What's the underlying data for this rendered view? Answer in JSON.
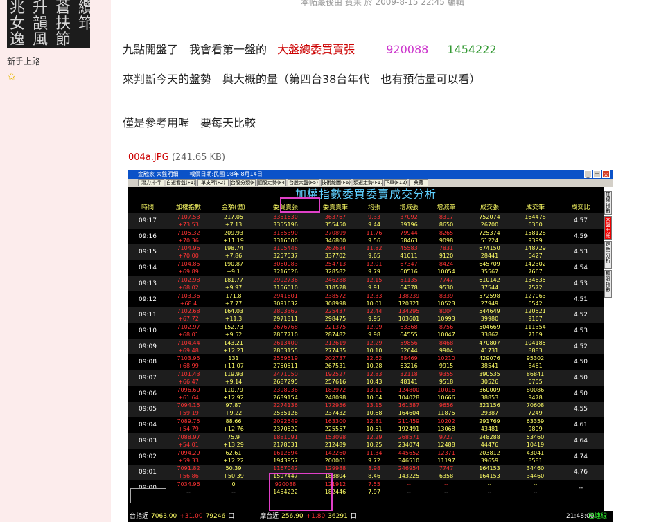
{
  "profile": {
    "avatar_rows": [
      "兆 升 蒼 纜",
      "女 韻 扶 筇 書",
      "逸 風 節"
    ],
    "rank": "新手上路",
    "star": "✩"
  },
  "post": {
    "edit_note": "本帖最後由 賓果 於 2009-8-15 22:45 編輯",
    "line1_a": "九點開盤了　我會看第一盤的",
    "line1_b": "大盤總委買賣張",
    "line1_c": "920088",
    "line1_d": "1454222",
    "line2": "來判斷今天的盤勢　與大概的量（第四台38台年代　也有預估量可以看）",
    "line3": "僅是參考用喔　要每天比較",
    "attachment_name": "004a.JPG",
    "attachment_size": "(241.65 KB)"
  },
  "app": {
    "window_title": "金融家 大盤明細　　報價日期:民國 98年 8月14日",
    "toolbar": [
      "潛力排行",
      "自選看盤(F1)",
      "單支所(F2)",
      "台股分類(F3)",
      "個股走勢(F4)",
      "台股大盤(F5)",
      "技術線圖(F6)",
      "類選走勢(F11)",
      "下單(F12)",
      "典藏"
    ],
    "title": "加權指數委買委賣成交分析",
    "headers": [
      "時間",
      "加權指數",
      "金額(億)",
      "委買賣張",
      "委賣賣筆",
      "均張",
      "增減張",
      "增減筆",
      "成交張",
      "成交筆",
      "成交比"
    ],
    "rows": [
      {
        "time": "09:17",
        "idx": "7107.53",
        "chg": "+73.53",
        "amt": "217.05",
        "amt2": "+7.13",
        "buy": "3351630",
        "buy2": "3355196",
        "sell": "363767",
        "sell2": "355450",
        "avg": "9.33",
        "avg2": "9.44",
        "dz": "37092",
        "dz2": "39196",
        "db": "8317",
        "db2": "8650",
        "vol": "752074",
        "vol2": "26700",
        "cnt": "164478",
        "cnt2": "6350",
        "ratio": "4.57"
      },
      {
        "time": "09:16",
        "idx": "7105.32",
        "chg": "+70.36",
        "amt": "209.93",
        "amt2": "+11.19",
        "buy": "3185390",
        "buy2": "3316000",
        "sell": "270899",
        "sell2": "346800",
        "avg": "11.76",
        "avg2": "9.56",
        "dz": "79944",
        "dz2": "58463",
        "db": "8265",
        "db2": "9098",
        "vol": "725374",
        "vol2": "51224",
        "cnt": "158128",
        "cnt2": "9399",
        "ratio": "4.59"
      },
      {
        "time": "09:15",
        "idx": "7104.96",
        "chg": "+70.00",
        "amt": "198.74",
        "amt2": "+7.86",
        "buy": "3105446",
        "buy2": "3257537",
        "sell": "262634",
        "sell2": "337702",
        "avg": "11.82",
        "avg2": "9.65",
        "dz": "45583",
        "dz2": "41011",
        "db": "7831",
        "db2": "9120",
        "vol": "674150",
        "vol2": "28441",
        "cnt": "148729",
        "cnt2": "6427",
        "ratio": "4.53"
      },
      {
        "time": "09:14",
        "idx": "7104.85",
        "chg": "+69.89",
        "amt": "190.87",
        "amt2": "+9.1",
        "buy": "3060083",
        "buy2": "3216526",
        "sell": "254713",
        "sell2": "328582",
        "avg": "12.01",
        "avg2": "9.79",
        "dz": "67347",
        "dz2": "60516",
        "db": "8424",
        "db2": "10054",
        "vol": "645709",
        "vol2": "35567",
        "cnt": "142302",
        "cnt2": "7667",
        "ratio": "4.54"
      },
      {
        "time": "09:13",
        "idx": "7102.98",
        "chg": "+68.02",
        "amt": "181.77",
        "amt2": "+9.97",
        "buy": "2992736",
        "buy2": "3156010",
        "sell": "246288",
        "sell2": "318528",
        "avg": "12.15",
        "avg2": "9.91",
        "dz": "51135",
        "dz2": "64378",
        "db": "7747",
        "db2": "9530",
        "vol": "610142",
        "vol2": "37544",
        "cnt": "134635",
        "cnt2": "7572",
        "ratio": "4.53"
      },
      {
        "time": "09:12",
        "idx": "7103.36",
        "chg": "+68.4",
        "amt": "171.8",
        "amt2": "+7.77",
        "buy": "2941601",
        "buy2": "3091632",
        "sell": "238572",
        "sell2": "308998",
        "avg": "12.33",
        "avg2": "10.01",
        "dz": "138239",
        "dz2": "120321",
        "db": "8339",
        "db2": "10523",
        "vol": "572598",
        "vol2": "27949",
        "cnt": "127063",
        "cnt2": "6542",
        "ratio": "4.51"
      },
      {
        "time": "09:11",
        "idx": "7102.68",
        "chg": "+67.72",
        "amt": "164.03",
        "amt2": "+11.3",
        "buy": "2803362",
        "buy2": "2971311",
        "sell": "225437",
        "sell2": "298475",
        "avg": "12.44",
        "avg2": "9.95",
        "dz": "134295",
        "dz2": "103601",
        "db": "8004",
        "db2": "10993",
        "vol": "544649",
        "vol2": "39980",
        "cnt": "120521",
        "cnt2": "9167",
        "ratio": "4.52"
      },
      {
        "time": "09:10",
        "idx": "7102.97",
        "chg": "+68.01",
        "amt": "152.73",
        "amt2": "+9.52",
        "buy": "2676768",
        "buy2": "2867710",
        "sell": "221375",
        "sell2": "287482",
        "avg": "12.09",
        "avg2": "9.98",
        "dz": "63368",
        "dz2": "64555",
        "db": "8756",
        "db2": "10047",
        "vol": "504669",
        "vol2": "33862",
        "cnt": "111354",
        "cnt2": "7169",
        "ratio": "4.53"
      },
      {
        "time": "09:09",
        "idx": "7104.44",
        "chg": "+69.48",
        "amt": "143.21",
        "amt2": "+12.21",
        "buy": "2613400",
        "buy2": "2803155",
        "sell": "212619",
        "sell2": "277435",
        "avg": "12.29",
        "avg2": "10.10",
        "dz": "59856",
        "dz2": "52644",
        "db": "8468",
        "db2": "9904",
        "vol": "470807",
        "vol2": "41731",
        "cnt": "104185",
        "cnt2": "8883",
        "ratio": "4.52"
      },
      {
        "time": "09:08",
        "idx": "7103.95",
        "chg": "+68.99",
        "amt": "131",
        "amt2": "+11.07",
        "buy": "2559519",
        "buy2": "2750511",
        "sell": "202737",
        "sell2": "267531",
        "avg": "12.62",
        "avg2": "10.28",
        "dz": "88469",
        "dz2": "63216",
        "db": "10210",
        "db2": "9915",
        "vol": "429076",
        "vol2": "38541",
        "cnt": "95302",
        "cnt2": "8461",
        "ratio": "4.50"
      },
      {
        "time": "09:07",
        "idx": "7101.43",
        "chg": "+66.47",
        "amt": "119.93",
        "amt2": "+9.14",
        "buy": "2471050",
        "buy2": "2687295",
        "sell": "192527",
        "sell2": "257616",
        "avg": "12.83",
        "avg2": "10.43",
        "dz": "32118",
        "dz2": "48141",
        "db": "9355",
        "db2": "9518",
        "vol": "390535",
        "vol2": "30526",
        "cnt": "86841",
        "cnt2": "6755",
        "ratio": "4.50"
      },
      {
        "time": "09:06",
        "idx": "7096.60",
        "chg": "+61.64",
        "amt": "110.79",
        "amt2": "+12.92",
        "buy": "2398936",
        "buy2": "2639154",
        "sell": "182972",
        "sell2": "248098",
        "avg": "13.11",
        "avg2": "10.64",
        "dz": "124800",
        "dz2": "104028",
        "db": "10016",
        "db2": "10666",
        "vol": "360009",
        "vol2": "38853",
        "cnt": "80086",
        "cnt2": "9478",
        "ratio": "4.50"
      },
      {
        "time": "09:05",
        "idx": "7094.15",
        "chg": "+59.19",
        "amt": "97.87",
        "amt2": "+9.22",
        "buy": "2274136",
        "buy2": "2535126",
        "sell": "172956",
        "sell2": "237432",
        "avg": "13.15",
        "avg2": "10.68",
        "dz": "161587",
        "dz2": "164604",
        "db": "9656",
        "db2": "11875",
        "vol": "321156",
        "vol2": "29387",
        "cnt": "70608",
        "cnt2": "7249",
        "ratio": "4.55"
      },
      {
        "time": "09:04",
        "idx": "7089.75",
        "chg": "+54.79",
        "amt": "88.66",
        "amt2": "+12.76",
        "buy": "2092549",
        "buy2": "2370522",
        "sell": "163300",
        "sell2": "225557",
        "avg": "12.81",
        "avg2": "10.51",
        "dz": "211459",
        "dz2": "192491",
        "db": "10202",
        "db2": "13068",
        "vol": "291769",
        "vol2": "43481",
        "cnt": "63359",
        "cnt2": "9899",
        "ratio": "4.61"
      },
      {
        "time": "09:03",
        "idx": "7088.97",
        "chg": "+54.01",
        "amt": "75.9",
        "amt2": "+13.29",
        "buy": "1881091",
        "buy2": "2178031",
        "sell": "153098",
        "sell2": "212489",
        "avg": "12.29",
        "avg2": "10.25",
        "dz": "268571",
        "dz2": "234074",
        "db": "9727",
        "db2": "12488",
        "vol": "248288",
        "vol2": "44476",
        "cnt": "53460",
        "cnt2": "10419",
        "ratio": "4.64"
      },
      {
        "time": "09:02",
        "idx": "7094.29",
        "chg": "+59.33",
        "amt": "62.61",
        "amt2": "+12.22",
        "buy": "1612694",
        "buy2": "1943957",
        "sell": "142260",
        "sell2": "200001",
        "avg": "11.34",
        "avg2": "9.72",
        "dz": "445652",
        "dz2": "346510",
        "db": "12371",
        "db2": "11197",
        "vol": "203812",
        "vol2": "39659",
        "cnt": "43041",
        "cnt2": "8581",
        "ratio": "4.74"
      },
      {
        "time": "09:01",
        "idx": "7091.82",
        "chg": "+56.86",
        "amt": "50.39",
        "amt2": "+50.39",
        "buy": "1167042",
        "buy2": "1597447",
        "sell": "129988",
        "sell2": "188804",
        "avg": "8.98",
        "avg2": "8.46",
        "dz": "246954",
        "dz2": "143225",
        "db": "7747",
        "db2": "6358",
        "vol": "164153",
        "vol2": "164153",
        "cnt": "34460",
        "cnt2": "34460",
        "ratio": "4.76"
      },
      {
        "time": "09:00",
        "idx": "7034.96",
        "chg": "--",
        "amt": "0",
        "amt2": "--",
        "buy": "920088",
        "buy2": "1454222",
        "sell": "121912",
        "sell2": "182446",
        "avg": "7.55",
        "avg2": "7.97",
        "dz": "--",
        "dz2": "--",
        "db": "--",
        "db2": "--",
        "vol": "--",
        "vol2": "--",
        "cnt": "--",
        "cnt2": "--",
        "ratio": "--"
      }
    ],
    "side_tabs": [
      "加權指數",
      "大盤明細",
      "走勢分析",
      "類股指數"
    ],
    "status": {
      "tw_label": "台指近",
      "tw_price": "7063.00",
      "tw_chg": "+31.00",
      "tw_vol": "79246",
      "tw_unit": "口",
      "mt_label": "摩台近",
      "mt_price": "256.90",
      "mt_chg": "+1.80",
      "mt_vol": "36291",
      "mt_unit": "口",
      "clock": "21:48:00",
      "conn": "已連線"
    },
    "colors": {
      "rise": "#ff3333",
      "header": "#ffff66",
      "title": "#5fd0ff",
      "highlight": "#e040c8"
    }
  }
}
